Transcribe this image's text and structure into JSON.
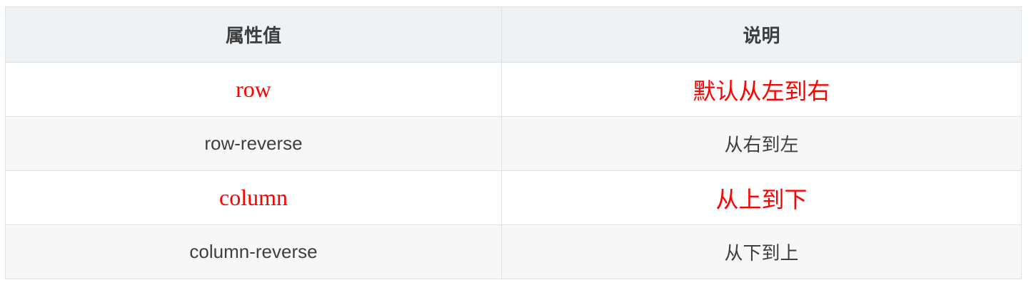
{
  "table": {
    "headers": [
      "属性值",
      "说明"
    ],
    "rows": [
      {
        "value": "row",
        "description": "默认从左到右",
        "highlight": true
      },
      {
        "value": "row-reverse",
        "description": "从右到左",
        "highlight": false
      },
      {
        "value": "column",
        "description": "从上到下",
        "highlight": true
      },
      {
        "value": "column-reverse",
        "description": "从下到上",
        "highlight": false
      }
    ]
  },
  "colors": {
    "highlight_text": "#ff0000",
    "header_background": "#eff2f5",
    "striped_row_background": "#f7f7f7",
    "border": "#dfe2e5"
  }
}
